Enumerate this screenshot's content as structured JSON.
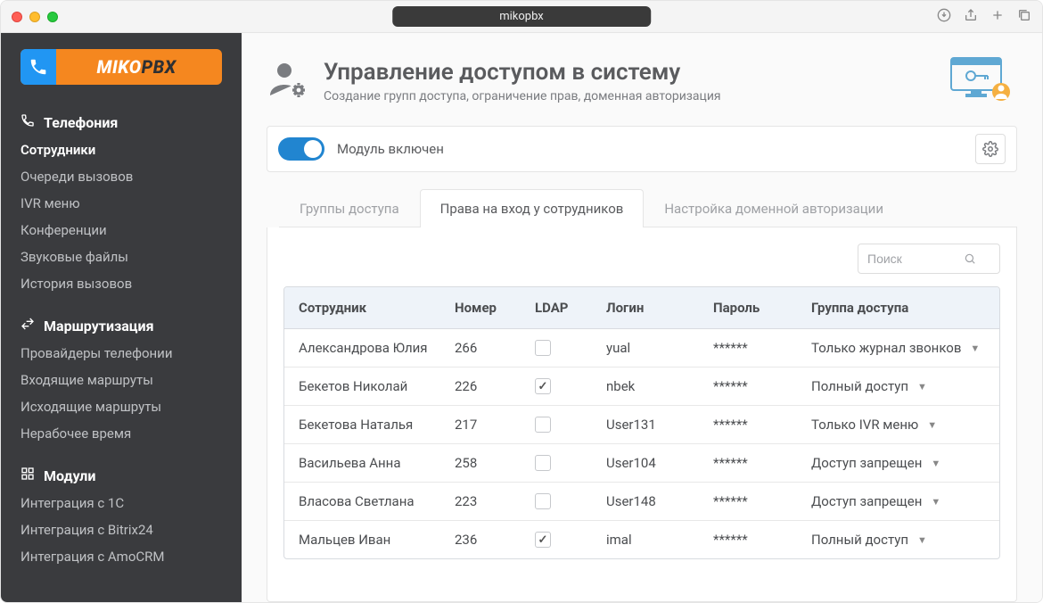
{
  "window": {
    "url": "mikopbx"
  },
  "logo": {
    "part1": "MIKO",
    "part2": "PBX"
  },
  "sidebar": {
    "sections": [
      {
        "title": "Телефония",
        "items": [
          "Сотрудники",
          "Очереди вызовов",
          "IVR меню",
          "Конференции",
          "Звуковые файлы",
          "История вызовов"
        ],
        "activeIndex": 0
      },
      {
        "title": "Маршрутизация",
        "items": [
          "Провайдеры телефонии",
          "Входящие маршруты",
          "Исходящие маршруты",
          "Нерабочее время"
        ],
        "activeIndex": -1
      },
      {
        "title": "Модули",
        "items": [
          "Интеграция с 1C",
          "Интеграция с Bitrix24",
          "Интеграция с AmoCRM"
        ],
        "activeIndex": -1
      }
    ]
  },
  "page": {
    "title": "Управление доступом в систему",
    "subtitle": "Создание групп доступа, ограничение прав, доменная авторизация"
  },
  "module": {
    "enabled": true,
    "label": "Модуль включен"
  },
  "tabs": {
    "items": [
      "Группы доступа",
      "Права на вход у сотрудников",
      "Настройка доменной авторизации"
    ],
    "active": 1
  },
  "search": {
    "placeholder": "Поиск"
  },
  "table": {
    "headers": {
      "name": "Сотрудник",
      "num": "Номер",
      "ldap": "LDAP",
      "login": "Логин",
      "pass": "Пароль",
      "group": "Группа доступа"
    },
    "rows": [
      {
        "name": "Александрова Юлия",
        "num": "266",
        "ldap": false,
        "login": "yual",
        "pass": "******",
        "group": "Только журнал звонков"
      },
      {
        "name": "Бекетов Николай",
        "num": "226",
        "ldap": true,
        "login": "nbek",
        "pass": "******",
        "group": "Полный доступ"
      },
      {
        "name": "Бекетова Наталья",
        "num": "217",
        "ldap": false,
        "login": "User131",
        "pass": "******",
        "group": "Только IVR меню"
      },
      {
        "name": "Васильева Анна",
        "num": "258",
        "ldap": false,
        "login": "User104",
        "pass": "******",
        "group": "Доступ запрещен"
      },
      {
        "name": "Власова Светлана",
        "num": "223",
        "ldap": false,
        "login": "User148",
        "pass": "******",
        "group": "Доступ запрещен"
      },
      {
        "name": "Мальцев Иван",
        "num": "236",
        "ldap": true,
        "login": "imal",
        "pass": "******",
        "group": "Полный доступ"
      }
    ]
  }
}
